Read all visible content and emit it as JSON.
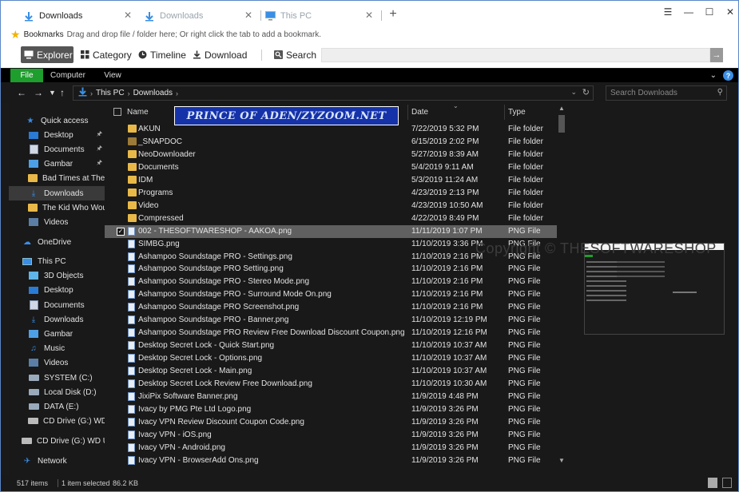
{
  "tabs": [
    {
      "label": "Downloads",
      "close": "✕",
      "icon": "download-arrow-icon",
      "active": true
    },
    {
      "label": "Downloads",
      "close": "✕",
      "icon": "download-arrow-icon",
      "active": false
    },
    {
      "label": "This PC",
      "close": "✕",
      "icon": "monitor-icon",
      "active": false
    }
  ],
  "new_tab": "+",
  "window_controls": {
    "menu": "☰",
    "minimize": "—",
    "maximize": "☐",
    "close": "✕"
  },
  "bookmarks": {
    "label": "Bookmarks",
    "hint": "Drag and drop file / folder here; Or right click the tab to add a bookmark."
  },
  "toolbar": {
    "explorer": "Explorer",
    "category": "Category",
    "timeline": "Timeline",
    "download": "Download",
    "search": "Search",
    "search_value": "",
    "go": "→"
  },
  "ribbon": {
    "file": "File",
    "computer": "Computer",
    "view": "View",
    "help": "?"
  },
  "address": {
    "crumbs": [
      "This PC",
      "Downloads"
    ],
    "search_placeholder": "Search Downloads"
  },
  "banner": "PRINCE OF ADEN/ZYZOOM.NET",
  "watermark": "Copyright © THESOFTWARESHOP",
  "columns": {
    "name": "Name",
    "date": "Date",
    "type": "Type"
  },
  "nav": [
    {
      "label": "Quick access",
      "icon": "star-icon",
      "pinned": false
    },
    {
      "label": "Desktop",
      "icon": "desktop-icon",
      "pinned": true
    },
    {
      "label": "Documents",
      "icon": "documents-icon",
      "pinned": true
    },
    {
      "label": "Gambar",
      "icon": "pictures-icon",
      "pinned": true
    },
    {
      "label": "Bad Times at The El",
      "icon": "folder-icon",
      "pinned": false
    },
    {
      "label": "Downloads",
      "icon": "downloads-icon",
      "pinned": false,
      "selected": true
    },
    {
      "label": "The Kid Who Would",
      "icon": "folder-icon",
      "pinned": false
    },
    {
      "label": "Videos",
      "icon": "videos-icon",
      "pinned": false
    },
    {
      "label": "OneDrive",
      "icon": "cloud-icon",
      "pinned": false
    },
    {
      "label": "This PC",
      "icon": "pc-icon",
      "pinned": false
    },
    {
      "label": "3D Objects",
      "icon": "objects-3d-icon",
      "pinned": false
    },
    {
      "label": "Desktop",
      "icon": "desktop-icon",
      "pinned": false
    },
    {
      "label": "Documents",
      "icon": "documents-icon",
      "pinned": false
    },
    {
      "label": "Downloads",
      "icon": "downloads-icon",
      "pinned": false
    },
    {
      "label": "Gambar",
      "icon": "pictures-icon",
      "pinned": false
    },
    {
      "label": "Music",
      "icon": "music-icon",
      "pinned": false
    },
    {
      "label": "Videos",
      "icon": "videos-icon",
      "pinned": false
    },
    {
      "label": "SYSTEM (C:)",
      "icon": "drive-icon",
      "pinned": false
    },
    {
      "label": "Local Disk (D:)",
      "icon": "drive-icon",
      "pinned": false
    },
    {
      "label": "DATA (E:)",
      "icon": "drive-icon",
      "pinned": false
    },
    {
      "label": "CD Drive (G:) WD Un",
      "icon": "cd-drive-icon",
      "pinned": false
    },
    {
      "label": "CD Drive (G:) WD Unl",
      "icon": "cd-drive-icon",
      "pinned": false
    },
    {
      "label": "Network",
      "icon": "network-icon",
      "pinned": false
    }
  ],
  "files": [
    {
      "name": "AKUN",
      "date": "7/22/2019 5:32 PM",
      "type": "File folder",
      "icon": "folder-icon"
    },
    {
      "name": "_SNAPDOC",
      "date": "6/15/2019 2:02 PM",
      "type": "File folder",
      "icon": "folder-icon"
    },
    {
      "name": "NeoDownloader",
      "date": "5/27/2019 8:39 AM",
      "type": "File folder",
      "icon": "folder-icon"
    },
    {
      "name": "Documents",
      "date": "5/4/2019 9:11 AM",
      "type": "File folder",
      "icon": "folder-icon"
    },
    {
      "name": "IDM",
      "date": "5/3/2019 11:24 AM",
      "type": "File folder",
      "icon": "folder-icon"
    },
    {
      "name": "Programs",
      "date": "4/23/2019 2:13 PM",
      "type": "File folder",
      "icon": "folder-icon"
    },
    {
      "name": "Video",
      "date": "4/23/2019 10:50 AM",
      "type": "File folder",
      "icon": "folder-icon"
    },
    {
      "name": "Compressed",
      "date": "4/22/2019 8:49 PM",
      "type": "File folder",
      "icon": "folder-icon"
    },
    {
      "name": "002 - THESOFTWARESHOP - AAKOA.png",
      "date": "11/11/2019 1:07 PM",
      "type": "PNG File",
      "icon": "png-file-icon",
      "selected": true
    },
    {
      "name": "SIMBG.png",
      "date": "11/10/2019 3:36 PM",
      "type": "PNG File",
      "icon": "png-file-icon"
    },
    {
      "name": "Ashampoo Soundstage PRO - Settings.png",
      "date": "11/10/2019 2:16 PM",
      "type": "PNG File",
      "icon": "png-file-icon"
    },
    {
      "name": "Ashampoo Soundstage PRO Setting.png",
      "date": "11/10/2019 2:16 PM",
      "type": "PNG File",
      "icon": "png-file-icon"
    },
    {
      "name": "Ashampoo Soundstage PRO - Stereo Mode.png",
      "date": "11/10/2019 2:16 PM",
      "type": "PNG File",
      "icon": "png-file-icon"
    },
    {
      "name": "Ashampoo Soundstage PRO - Surround Mode On.png",
      "date": "11/10/2019 2:16 PM",
      "type": "PNG File",
      "icon": "png-file-icon"
    },
    {
      "name": "Ashampoo Soundstage PRO Screenshot.png",
      "date": "11/10/2019 2:16 PM",
      "type": "PNG File",
      "icon": "png-file-icon"
    },
    {
      "name": "Ashampoo Soundstage PRO - Banner.png",
      "date": "11/10/2019 12:19 PM",
      "type": "PNG File",
      "icon": "png-file-icon"
    },
    {
      "name": "Ashampoo Soundstage PRO Review Free Download Discount Coupon.png",
      "date": "11/10/2019 12:16 PM",
      "type": "PNG File",
      "icon": "png-file-icon"
    },
    {
      "name": "Desktop Secret Lock - Quick Start.png",
      "date": "11/10/2019 10:37 AM",
      "type": "PNG File",
      "icon": "png-file-icon"
    },
    {
      "name": "Desktop Secret Lock - Options.png",
      "date": "11/10/2019 10:37 AM",
      "type": "PNG File",
      "icon": "png-file-icon"
    },
    {
      "name": "Desktop Secret Lock - Main.png",
      "date": "11/10/2019 10:37 AM",
      "type": "PNG File",
      "icon": "png-file-icon"
    },
    {
      "name": "Desktop Secret Lock Review Free Download.png",
      "date": "11/10/2019 10:30 AM",
      "type": "PNG File",
      "icon": "png-file-icon"
    },
    {
      "name": "JixiPix Software Banner.png",
      "date": "11/9/2019 4:48 PM",
      "type": "PNG File",
      "icon": "png-file-icon"
    },
    {
      "name": "Ivacy by PMG Pte Ltd Logo.png",
      "date": "11/9/2019 3:26 PM",
      "type": "PNG File",
      "icon": "png-file-icon"
    },
    {
      "name": "Ivacy VPN Review Discount Coupon Code.png",
      "date": "11/9/2019 3:26 PM",
      "type": "PNG File",
      "icon": "png-file-icon"
    },
    {
      "name": "Ivacy VPN - iOS.png",
      "date": "11/9/2019 3:26 PM",
      "type": "PNG File",
      "icon": "png-file-icon"
    },
    {
      "name": "Ivacy VPN - Android.png",
      "date": "11/9/2019 3:26 PM",
      "type": "PNG File",
      "icon": "png-file-icon"
    },
    {
      "name": "Ivacy VPN - BrowserAdd Ons.png",
      "date": "11/9/2019 3:26 PM",
      "type": "PNG File",
      "icon": "png-file-icon"
    }
  ],
  "status": {
    "count": "517 items",
    "selected": "1 item selected",
    "size": "86.2 KB"
  },
  "colors": {
    "accent": "#3a8ee6",
    "file_tab": "#1e9e2c",
    "folder": "#e8b948",
    "background": "#191919"
  }
}
